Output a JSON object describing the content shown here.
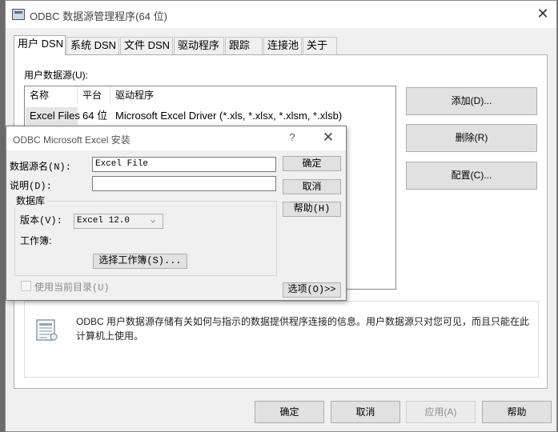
{
  "main_window": {
    "title": "ODBC 数据源管理程序(64 位)",
    "close_glyph": "✕",
    "tabs": [
      {
        "label": "用户 DSN",
        "active": true
      },
      {
        "label": "系统 DSN",
        "active": false
      },
      {
        "label": "文件 DSN",
        "active": false
      },
      {
        "label": "驱动程序",
        "active": false
      },
      {
        "label": "跟踪",
        "active": false
      },
      {
        "label": "连接池",
        "active": false
      },
      {
        "label": "关于",
        "active": false
      }
    ],
    "user_dsn_label": "用户数据源(U):",
    "dsn_table": {
      "columns": [
        "名称",
        "平台",
        "驱动程序"
      ],
      "rows": [
        {
          "name": "Excel Files",
          "platform": "64 位",
          "driver": "Microsoft Excel Driver (*.xls, *.xlsx, *.xlsm, *.xlsb)"
        }
      ]
    },
    "side_buttons": {
      "add": "添加(D)...",
      "remove": "删除(R)",
      "configure": "配置(C)..."
    },
    "info_text": "ODBC 用户数据源存储有关如何与指示的数据提供程序连接的信息。用户数据源只对您可见，而且只能在此计算机上使用。",
    "footer_buttons": {
      "ok": "确定",
      "cancel": "取消",
      "apply": "应用(A)",
      "help": "帮助"
    }
  },
  "excel_dialog": {
    "title": "ODBC Microsoft Excel 安装",
    "help_glyph": "?",
    "close_glyph": "✕",
    "dsn_name_label": "数据源名(N):",
    "dsn_name_value": "Excel File",
    "description_label": "说明(D):",
    "description_value": "",
    "database_group_label": "数据库",
    "version_label": "版本(V):",
    "version_value": "Excel 12.0",
    "workbook_label": "工作簿:",
    "select_workbook_button": "选择工作簿(S)...",
    "use_current_dir_label": "使用当前目录(U)",
    "use_current_dir_checked": false,
    "buttons": {
      "ok": "确定",
      "cancel": "取消",
      "help": "帮助(H)",
      "options": "选项(O)>>"
    }
  }
}
